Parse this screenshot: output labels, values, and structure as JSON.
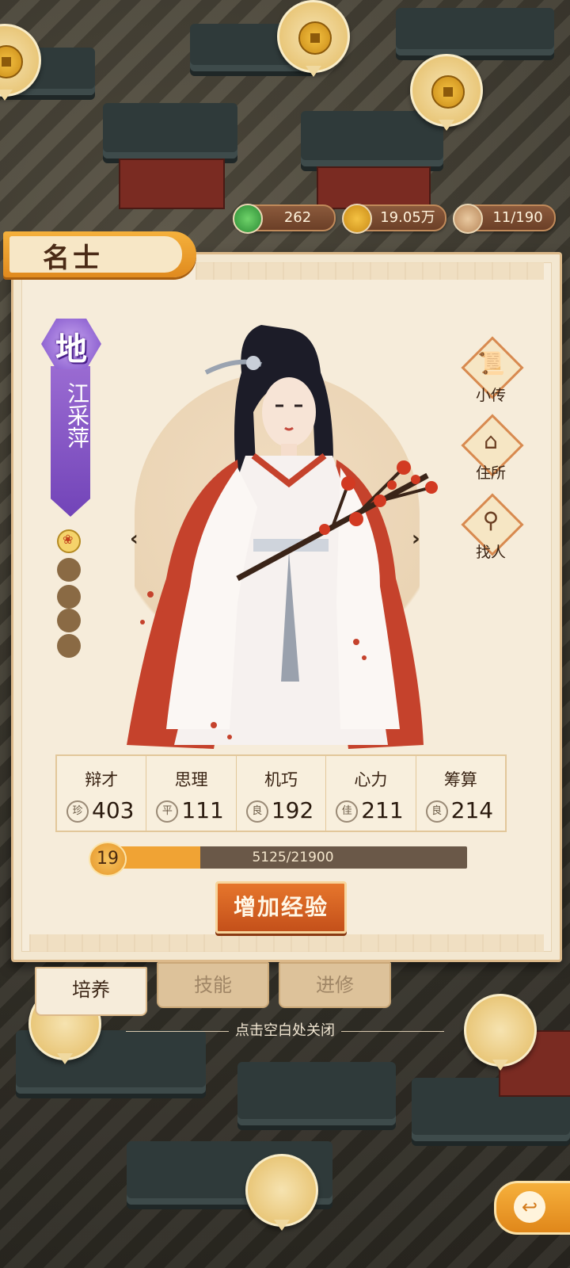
{
  "resources": [
    {
      "name": "jade",
      "icon": "jade-icon",
      "value": "262"
    },
    {
      "name": "coins",
      "icon": "coin-icon",
      "value": "19.05万"
    },
    {
      "name": "population",
      "icon": "villager-icon",
      "value": "11/190"
    }
  ],
  "panel": {
    "title": "名士",
    "rank": "地",
    "name": "江采萍",
    "star_dots": {
      "filled": 1,
      "total": 5
    }
  },
  "side_buttons": [
    {
      "label": "小传",
      "icon": "scroll-icon"
    },
    {
      "label": "住所",
      "icon": "house-icon"
    },
    {
      "label": "找人",
      "icon": "search-person-icon"
    }
  ],
  "stats": [
    {
      "name": "辩才",
      "grade": "珍",
      "value": "403"
    },
    {
      "name": "思理",
      "grade": "平",
      "value": "111"
    },
    {
      "name": "机巧",
      "grade": "良",
      "value": "192"
    },
    {
      "name": "心力",
      "grade": "佳",
      "value": "211"
    },
    {
      "name": "筹算",
      "grade": "良",
      "value": "214"
    }
  ],
  "level": {
    "value": "19",
    "exp_text": "5125/21900",
    "progress": 0.234
  },
  "exp_button": "增加经验",
  "tabs": [
    {
      "label": "培养",
      "active": true
    },
    {
      "label": "技能",
      "active": false
    },
    {
      "label": "进修",
      "active": false
    }
  ],
  "close_hint": "点击空白处关闭",
  "colors": {
    "accent": "#e0871a",
    "rank_purple": "#7d4fc8",
    "exp_fill": "#f0a334"
  }
}
